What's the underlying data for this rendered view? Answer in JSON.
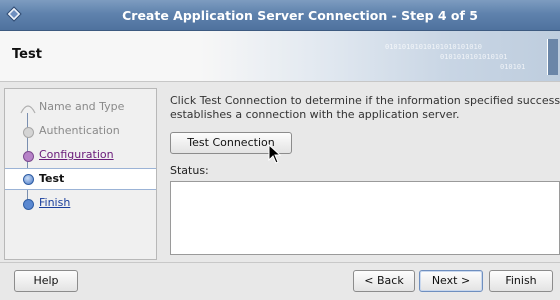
{
  "window": {
    "title": "Create Application Server Connection - Step 4 of 5"
  },
  "header": {
    "title": "Test",
    "binary_lines": [
      "01010101010101010101010",
      "0101010101010101",
      "010101"
    ]
  },
  "steps": [
    {
      "label": "Name and Type",
      "state": "done"
    },
    {
      "label": "Authentication",
      "state": "done"
    },
    {
      "label": "Configuration",
      "state": "link-visited"
    },
    {
      "label": "Test",
      "state": "current"
    },
    {
      "label": "Finish",
      "state": "link"
    }
  ],
  "content": {
    "description_line1": "Click Test Connection to determine if the information specified successfully",
    "description_line2": "establishes a connection with the application server.",
    "test_button": "Test Connection",
    "status_label": "Status:",
    "status_value": ""
  },
  "footer": {
    "help": "Help",
    "back": "< Back",
    "next": "Next >",
    "finish": "Finish"
  },
  "colors": {
    "titlebar": "#5f82ad",
    "step_current_dot": "#4a7ac8",
    "step_visited_dot": "#9a5fb0",
    "step_done_dot": "#c0c0c0",
    "step_link_dot": "#4a7ac8"
  }
}
